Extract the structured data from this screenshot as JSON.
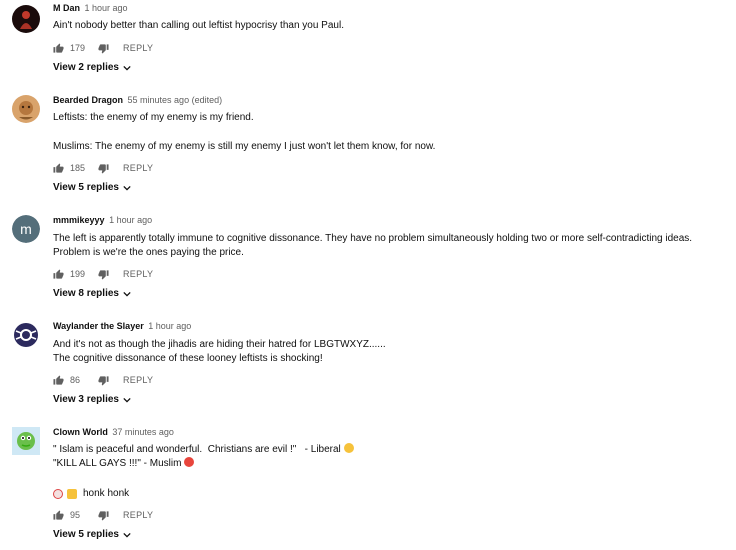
{
  "comments": [
    {
      "author": "M Dan",
      "time": "1 hour ago",
      "text": "Ain't nobody better than calling out leftist hypocrisy than you Paul.",
      "likes": "179",
      "reply_label": "REPLY",
      "replies_label": "View 2 replies",
      "avatar": "red-figure-avatar"
    },
    {
      "author": "Bearded Dragon",
      "time": "55 minutes ago (edited)",
      "text_line1": "Leftists: the enemy of my enemy is my friend.",
      "text_line2": "Muslims: The enemy of my enemy is still my enemy I just won't let them know, for now.",
      "likes": "185",
      "reply_label": "REPLY",
      "replies_label": "View 5 replies",
      "avatar": "bearded-dragon-avatar"
    },
    {
      "author": "mmmikeyyy",
      "time": "1 hour ago",
      "avatar_letter": "m",
      "text": "The left is apparently totally immune to cognitive dissonance. They have no problem simultaneously holding two or more self-contradicting ideas. Problem is we're the ones paying the price.",
      "likes": "199",
      "reply_label": "REPLY",
      "replies_label": "View 8 replies",
      "avatar_color": "#546e7a"
    },
    {
      "author": "Waylander the Slayer",
      "time": "1 hour ago",
      "text_line1": "And it's not as though the jihadis are hiding their hatred for LBGTWXYZ......",
      "text_line2": "The cognitive dissonance of these looney leftists is shocking!",
      "likes": "86",
      "reply_label": "REPLY",
      "replies_label": "View 3 replies",
      "avatar": "lion-logo-avatar"
    },
    {
      "author": "Clown World",
      "time": "37 minutes ago",
      "text_line1": "\" Islam is peaceful and wonderful.  Christians are evil !\"   - Liberal",
      "text_line2": "\"KILL ALL GAYS !!!\" - Muslim",
      "text_line3": "honk honk",
      "likes": "95",
      "reply_label": "REPLY",
      "replies_label": "View 5 replies",
      "avatar": "pepe-avatar"
    }
  ],
  "icons": {
    "like": "thumb-up-icon",
    "dislike": "thumb-down-icon",
    "expand": "chevron-down-icon"
  }
}
